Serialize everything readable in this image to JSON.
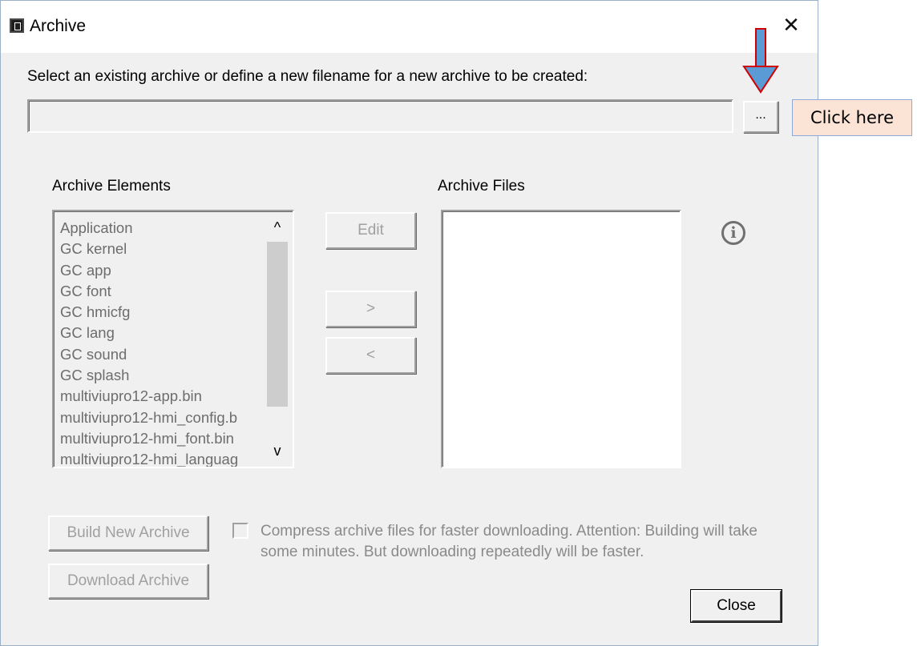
{
  "window": {
    "title": "Archive",
    "close_glyph": "✕",
    "icon": "app-icon"
  },
  "archive_path": {
    "label": "Select an existing archive or define a new filename for a new archive to be created:",
    "value": "",
    "browse_label": "..."
  },
  "elements": {
    "header": "Archive Elements",
    "items": [
      "Application",
      "GC kernel",
      "GC app",
      "GC font",
      "GC hmicfg",
      "GC lang",
      "GC sound",
      "GC splash",
      "multiviupro12-app.bin",
      "multiviupro12-hmi_config.b",
      "multiviupro12-hmi_font.bin",
      "multiviupro12-hmi_languag"
    ]
  },
  "files": {
    "header": "Archive Files",
    "items": []
  },
  "actions": {
    "edit_label": "Edit",
    "add_label": ">",
    "remove_label": "<",
    "build_label": "Build New Archive",
    "download_label": "Download Archive",
    "close_label": "Close"
  },
  "compress": {
    "checked": false,
    "label": "Compress archive files for faster downloading. Attention: Building will take some minutes. But downloading repeatedly will be faster."
  },
  "annotation": {
    "callout_text": "Click here",
    "arrow_color": "#5b9bd5",
    "arrow_border": "#d00000",
    "callout_bg": "#fbe4d5"
  },
  "icons": {
    "info": "info-icon",
    "scroll_up": "chevron-up-icon",
    "scroll_down": "chevron-down-icon"
  }
}
